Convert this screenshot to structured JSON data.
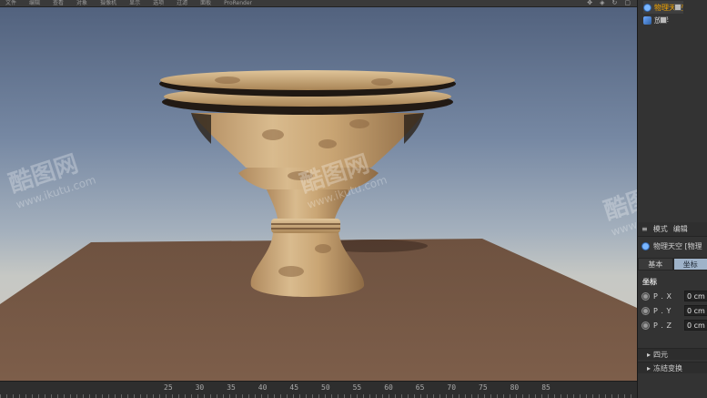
{
  "menu": {
    "items": [
      "文件",
      "编辑",
      "查看",
      "对象",
      "摄像机",
      "显示",
      "选项",
      "过滤",
      "面板",
      "ProRender"
    ]
  },
  "viewport": {
    "watermarks": [
      {
        "logo": "酷图网",
        "url": "www.ikutu.com"
      },
      {
        "logo": "酷图网",
        "url": "www.ikutu.com"
      },
      {
        "logo": "酷图网",
        "url": "www.ikutu.com"
      }
    ]
  },
  "timeline": {
    "frames": [
      "25",
      "30",
      "35",
      "40",
      "45",
      "50",
      "55",
      "60",
      "65",
      "70",
      "75",
      "80",
      "85"
    ]
  },
  "object_manager": {
    "items": [
      {
        "label": "物理天空",
        "icon": "sky-icon",
        "selected": true
      },
      {
        "label": "放样",
        "icon": "loft-icon",
        "selected": false
      }
    ]
  },
  "attributes": {
    "header_mode": "模式",
    "header_edit": "编辑",
    "object_name": "物理天空 [物理",
    "tabs": [
      "基本",
      "坐标"
    ],
    "active_tab": "坐标",
    "section_title": "坐标",
    "fields": [
      {
        "label": "P . X",
        "value": "0 cm"
      },
      {
        "label": "P . Y",
        "value": "0 cm"
      },
      {
        "label": "P . Z",
        "value": "0 cm"
      }
    ],
    "collapsed_groups": [
      "四元",
      "冻结变换"
    ]
  },
  "colors": {
    "selected_text": "#f2a400",
    "active_tab": "#9fb3c9",
    "ground": "#7a5b48"
  }
}
